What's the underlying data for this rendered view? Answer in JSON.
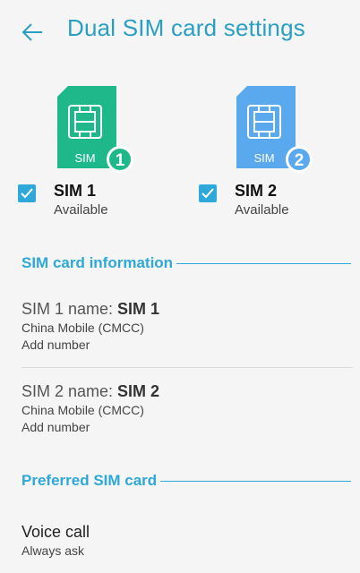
{
  "header": {
    "title": "Dual SIM card settings",
    "back_icon": "arrow-left-icon"
  },
  "colors": {
    "accent": "#2ea8d8",
    "sim1": "#1fb88a",
    "sim2": "#5aa9ef"
  },
  "sims": [
    {
      "label": "SIM 1",
      "status": "Available",
      "card_text": "SIM",
      "badge": "1",
      "checked": true
    },
    {
      "label": "SIM 2",
      "status": "Available",
      "card_text": "SIM",
      "badge": "2",
      "checked": true
    }
  ],
  "sim_info": {
    "section_title": "SIM card information",
    "items": [
      {
        "name_prefix": "SIM 1 name: ",
        "name_value": "SIM 1",
        "carrier": "China Mobile (CMCC)",
        "action": "Add number"
      },
      {
        "name_prefix": "SIM 2 name: ",
        "name_value": "SIM 2",
        "carrier": "China Mobile (CMCC)",
        "action": "Add number"
      }
    ]
  },
  "preferred": {
    "section_title": "Preferred SIM card",
    "voice_call": {
      "title": "Voice call",
      "value": "Always ask"
    }
  }
}
